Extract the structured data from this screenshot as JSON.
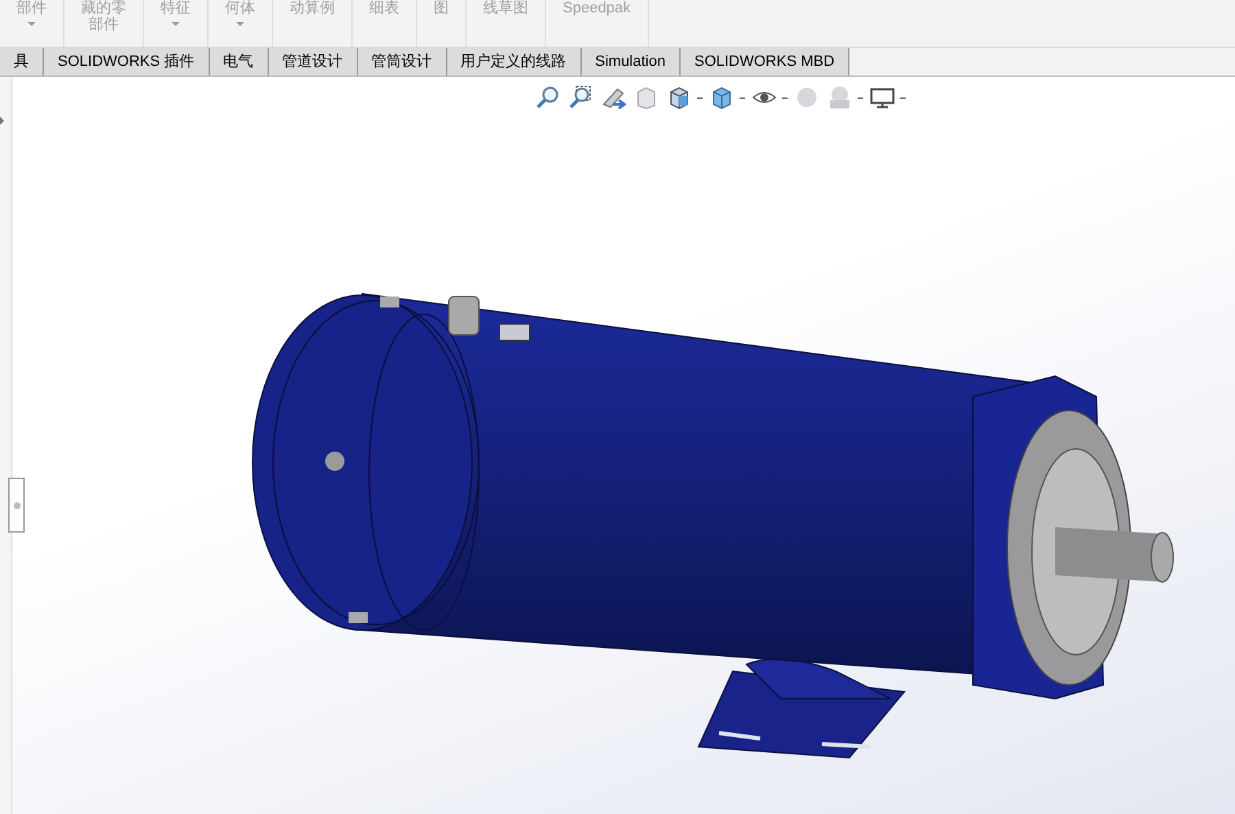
{
  "ribbon": {
    "buttons": [
      {
        "label": "部件",
        "caret": true
      },
      {
        "lines": [
          "藏的零",
          "部件"
        ],
        "caret": false
      },
      {
        "label": "特征",
        "caret": true
      },
      {
        "label": "何体",
        "caret": true
      },
      {
        "label": "动算例",
        "caret": false
      },
      {
        "label": "细表",
        "caret": false
      },
      {
        "label": "图",
        "caret": false
      },
      {
        "label": "线草图",
        "caret": false
      },
      {
        "label": "Speedpak",
        "caret": false
      }
    ]
  },
  "tabs": [
    {
      "label": "具",
      "selected": false
    },
    {
      "label": "SOLIDWORKS 插件",
      "selected": false
    },
    {
      "label": "电气",
      "selected": false
    },
    {
      "label": "管道设计",
      "selected": false
    },
    {
      "label": "管筒设计",
      "selected": false
    },
    {
      "label": "用户定义的线路",
      "selected": false
    },
    {
      "label": "Simulation",
      "selected": false
    },
    {
      "label": "SOLIDWORKS MBD",
      "selected": false
    }
  ],
  "view_toolbar": [
    {
      "kind": "zoom-fit"
    },
    {
      "kind": "zoom-area"
    },
    {
      "kind": "previous"
    },
    {
      "kind": "section"
    },
    {
      "kind": "orientation",
      "caret": true
    },
    {
      "kind": "display",
      "caret": true
    },
    {
      "kind": "hide",
      "caret": true
    },
    {
      "kind": "appearance"
    },
    {
      "kind": "scene",
      "caret": true
    },
    {
      "kind": "monitor",
      "caret": true
    }
  ]
}
